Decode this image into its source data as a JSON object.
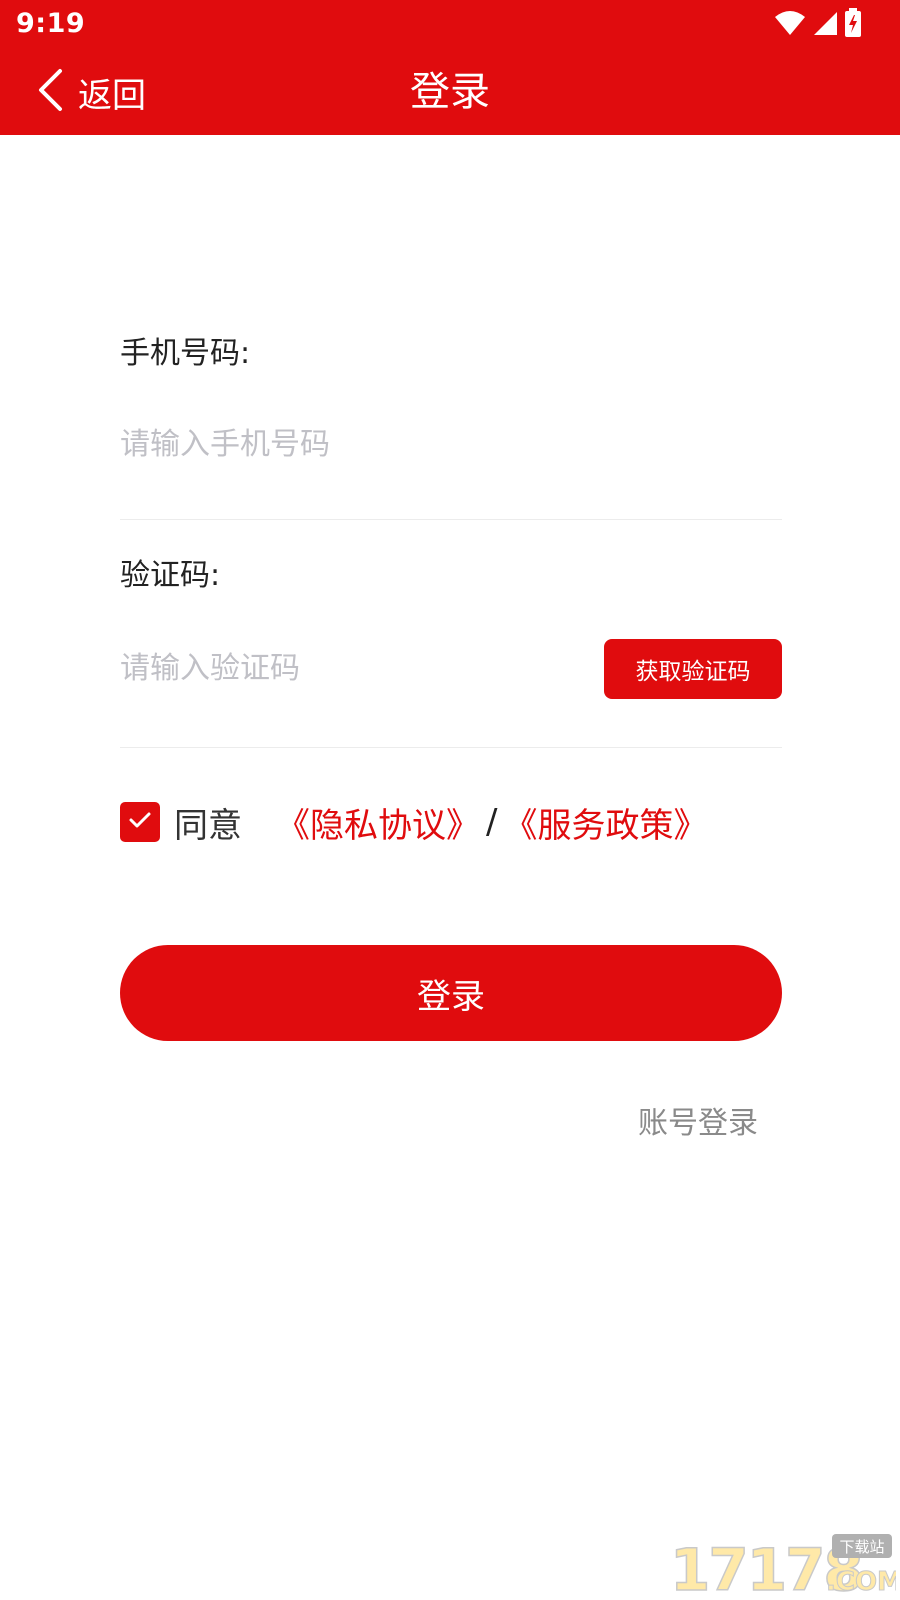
{
  "status_bar": {
    "time": "9:19"
  },
  "header": {
    "back_label": "返回",
    "title": "登录",
    "background_color": "#e00c0e"
  },
  "form": {
    "phone": {
      "label": "手机号码:",
      "placeholder": "请输入手机号码",
      "value": ""
    },
    "code": {
      "label": "验证码:",
      "placeholder": "请输入验证码",
      "value": "",
      "get_code_label": "获取验证码"
    },
    "agreement": {
      "checked": true,
      "agree_label": "同意",
      "privacy_label": "《隐私协议》",
      "separator": "/",
      "service_label": "《服务政策》"
    },
    "login_label": "登录",
    "account_login_label": "账号登录"
  },
  "watermark": {
    "text": "17178",
    "sub": "下载站",
    "suffix": ".COM"
  },
  "colors": {
    "accent": "#e00c0e",
    "placeholder": "#c0c0c6",
    "divider": "#ececec",
    "secondary_text": "#8a8a8a"
  }
}
